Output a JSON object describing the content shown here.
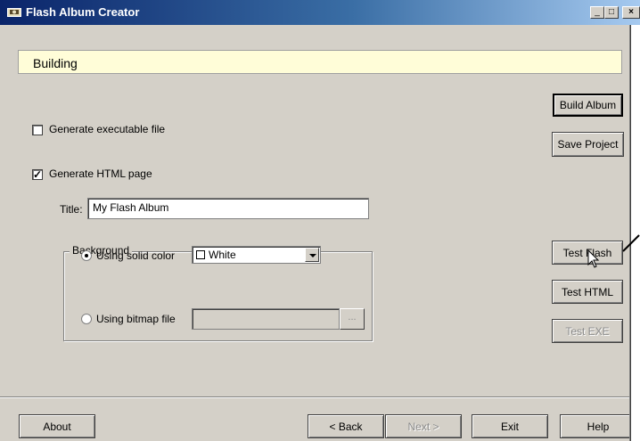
{
  "window": {
    "title": "Flash Album Creator",
    "controls": {
      "minimize": "_",
      "maximize": "□",
      "close": "×"
    }
  },
  "status_text": "Building",
  "options": {
    "generate_exe": {
      "label": "Generate executable file",
      "checked": false
    },
    "generate_html": {
      "label": "Generate HTML page",
      "checked": true
    }
  },
  "title_field": {
    "label": "Title:",
    "value": "My Flash Album"
  },
  "background": {
    "group_label": "Background",
    "solid_color": {
      "label": "Using solid color",
      "selected": true,
      "color_value": "White",
      "swatch_color": "#ffffff"
    },
    "bitmap_file": {
      "label": "Using bitmap file",
      "selected": false,
      "browse_label": "..."
    }
  },
  "side_buttons": {
    "build_album": "Build Album",
    "save_project": "Save Project",
    "test_flash": "Test Flash",
    "test_html": "Test HTML",
    "test_exe": "Test EXE"
  },
  "bottom_buttons": {
    "about": "About",
    "back": "< Back",
    "next": "Next >",
    "exit": "Exit",
    "help": "Help"
  },
  "icons": {
    "app": "album-icon",
    "cursor": "mouse-pointer-icon",
    "browse": "ellipsis-icon",
    "dropdown": "chevron-down-icon"
  }
}
